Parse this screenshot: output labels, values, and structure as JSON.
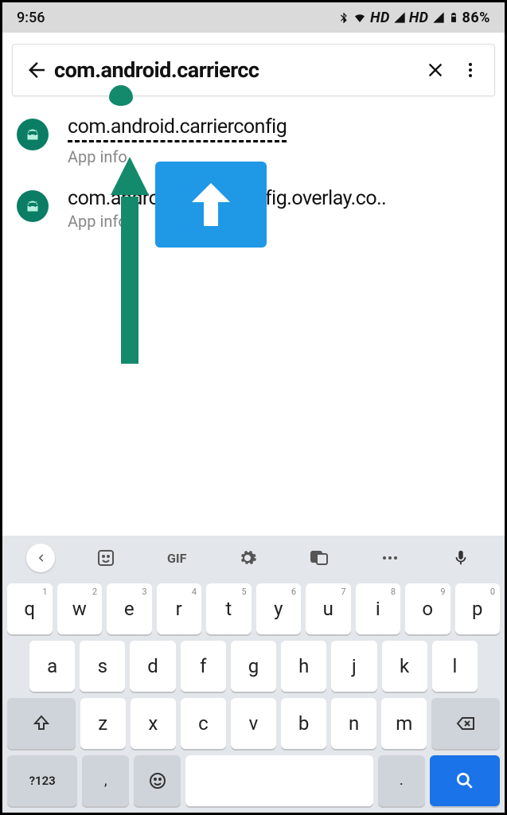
{
  "status": {
    "time": "9:56",
    "hd": "HD",
    "battery": "86%"
  },
  "search": {
    "value": "com.android.carriercc"
  },
  "results": [
    {
      "title": "com.android.carrierconfig",
      "subtitle": "App info",
      "underline": true
    },
    {
      "title": "com.android.carrierconfig.overlay.co..",
      "subtitle": "App info",
      "underline": false
    }
  ],
  "keyboard": {
    "tools": {
      "gif": "GIF"
    },
    "row1": [
      [
        "q",
        "1"
      ],
      [
        "w",
        "2"
      ],
      [
        "e",
        "3"
      ],
      [
        "r",
        "4"
      ],
      [
        "t",
        "5"
      ],
      [
        "y",
        "6"
      ],
      [
        "u",
        "7"
      ],
      [
        "i",
        "8"
      ],
      [
        "o",
        "9"
      ],
      [
        "p",
        "0"
      ]
    ],
    "row2": [
      "a",
      "s",
      "d",
      "f",
      "g",
      "h",
      "j",
      "k",
      "l"
    ],
    "row3": [
      "z",
      "x",
      "c",
      "v",
      "b",
      "n",
      "m"
    ],
    "row4": {
      "sym": "?123",
      "comma": ",",
      "period": "."
    }
  }
}
